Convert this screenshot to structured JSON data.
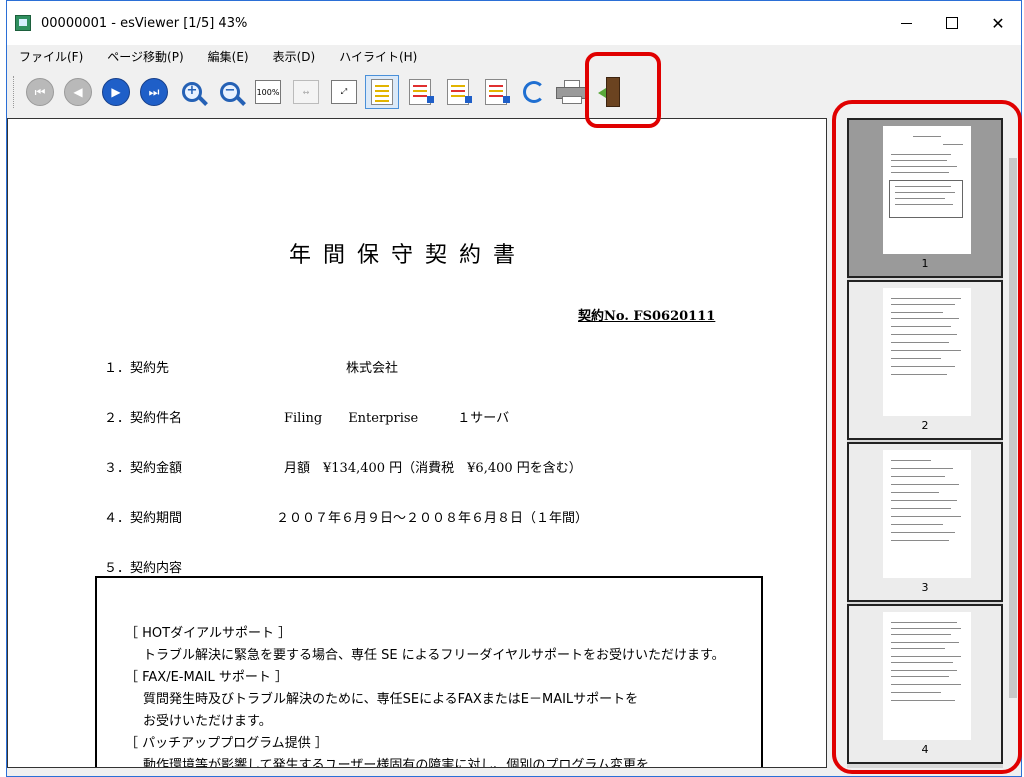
{
  "window": {
    "title": "00000001 - esViewer  [1/5] 43%"
  },
  "menu": [
    "ファイル(F)",
    "ページ移動(P)",
    "編集(E)",
    "表示(D)",
    "ハイライト(H)"
  ],
  "toolbar": {
    "zoom_100_label": "100%"
  },
  "document": {
    "title": "年間保守契約書",
    "contract_no": "契約No. FS0620111",
    "fields": [
      {
        "label": "１．契約先",
        "value": "株式会社"
      },
      {
        "label": "２．契約件名",
        "value": "Filing　　Enterprise　　　１サーバ"
      },
      {
        "label": "３．契約金額",
        "value": "月額　¥134,400 円（消費税　¥6,400 円を含む）"
      },
      {
        "label": "４．契約期間",
        "value": "２００７年６月９日～２００８年６月８日（１年間）"
      },
      {
        "label": "５．契約内容",
        "value": ""
      }
    ],
    "content_lines": [
      "［ HOTダイアルサポート ］",
      "トラブル解決に緊急を要する場合、専任 SE によるフリーダイヤルサポートをお受けいただけます。",
      "［ FAX/E-MAIL サポート ］",
      "質問発生時及びトラブル解決のために、専任SEによるFAXまたはE－MAILサポートを",
      "お受けいただけます。",
      "［ パッチアッププログラム提供 ］",
      "動作環境等が影響して発生するユーザー様固有の障害に対し、個別のプログラム変更を"
    ]
  },
  "thumbnails": [
    "1",
    "2",
    "3",
    "4"
  ],
  "colors": {
    "highlight": "#e00000",
    "accent": "#1f5fc8"
  }
}
